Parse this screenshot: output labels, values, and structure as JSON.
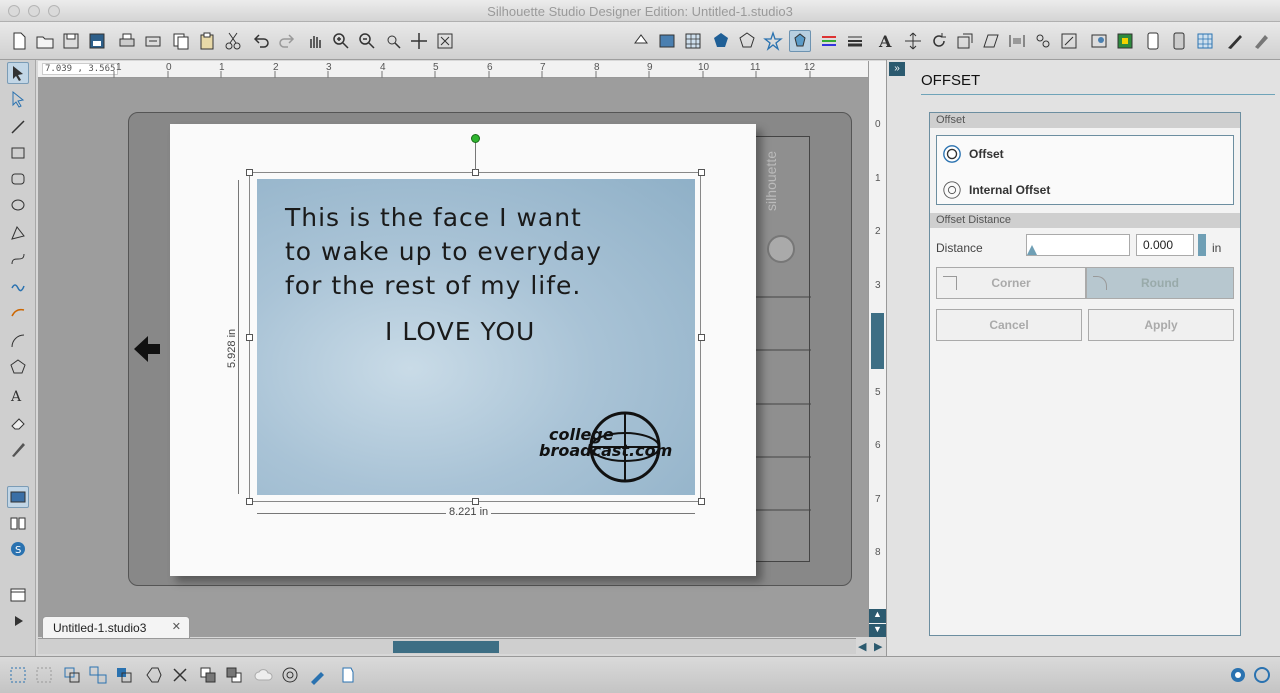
{
  "window": {
    "title": "Silhouette Studio Designer Edition: Untitled-1.studio3"
  },
  "ruler": {
    "coord_readout": "7.039 , 3.565",
    "h_ticks": [
      "1",
      "0",
      "1",
      "2",
      "3",
      "4",
      "5",
      "6",
      "7",
      "8",
      "9",
      "10",
      "11",
      "12"
    ],
    "v_ticks": [
      "0",
      "1",
      "2",
      "3",
      "4",
      "5",
      "6",
      "7",
      "8"
    ]
  },
  "canvas": {
    "photo_text": {
      "line1": "This is the face I want",
      "line2": "to wake up to everyday",
      "line3": "for the rest of my life.",
      "line4": "I LOVE YOU",
      "logo_line1": "college",
      "logo_line2": "broadcast.com"
    },
    "height_label": "5.928 in",
    "width_label": "8.221 in",
    "mat_brand": "silhouette"
  },
  "tabs": [
    {
      "label": "Untitled-1.studio3"
    }
  ],
  "panel": {
    "title": "OFFSET",
    "offset_section": "Offset",
    "options": [
      {
        "label": "Offset"
      },
      {
        "label": "Internal Offset"
      }
    ],
    "distance_section": "Offset Distance",
    "distance_label": "Distance",
    "distance_value": "0.000",
    "distance_unit": "in",
    "corner_label": "Corner",
    "round_label": "Round",
    "cancel_label": "Cancel",
    "apply_label": "Apply"
  }
}
